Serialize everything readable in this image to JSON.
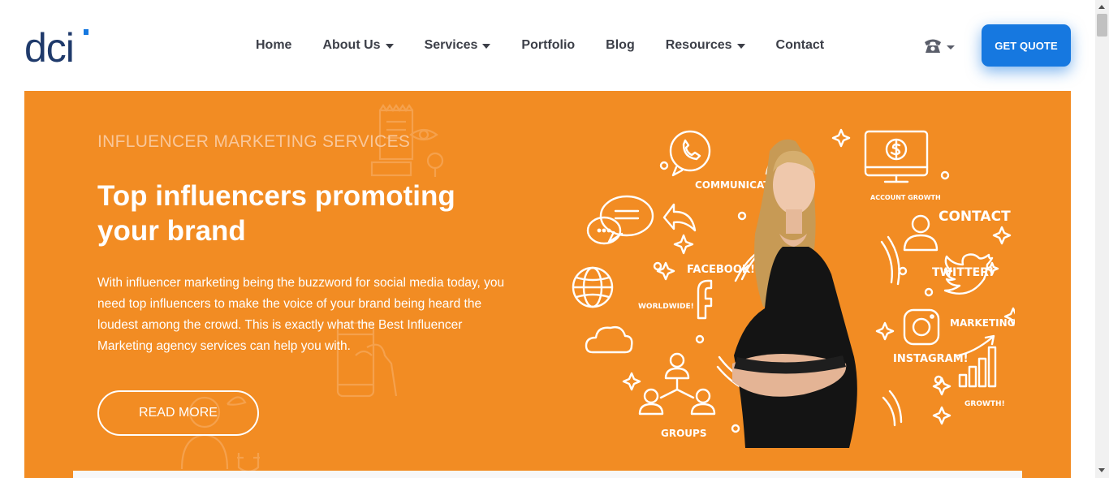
{
  "header": {
    "logo_text": "dci",
    "nav": [
      {
        "label": "Home",
        "dropdown": false
      },
      {
        "label": "About Us",
        "dropdown": true
      },
      {
        "label": "Services",
        "dropdown": true
      },
      {
        "label": "Portfolio",
        "dropdown": false
      },
      {
        "label": "Blog",
        "dropdown": false
      },
      {
        "label": "Resources",
        "dropdown": true
      },
      {
        "label": "Contact",
        "dropdown": false
      }
    ],
    "phone_icon": "☎",
    "quote_label": "GET QUOTE"
  },
  "hero": {
    "eyebrow": "INFLUENCER MARKETING SERVICES",
    "headline": "Top influencers promoting your brand",
    "body": "With influencer marketing being the buzzword for social media today, you need top influencers to make the voice of your brand being heard the loudest among the crowd. This is exactly what the Best Influencer Marketing agency services can help you with.",
    "cta_label": "READ MORE"
  },
  "illustration": {
    "labels": {
      "communication": "COMMUNICATION",
      "account_growth": "ACCOUNT GROWTH",
      "contact": "CONTACT",
      "twitter": "TWITTER!",
      "facebook": "FACEBOOK!",
      "worldwide": "WORLDWIDE!",
      "marketing": "MARKETING",
      "instagram": "INSTAGRAM!",
      "growth": "GROWTH!",
      "groups": "GROUPS"
    }
  },
  "colors": {
    "brand_blue": "#1678e0",
    "logo_navy": "#1f3a6b",
    "hero_orange": "#f28c23",
    "nav_text": "#3c3f48"
  }
}
